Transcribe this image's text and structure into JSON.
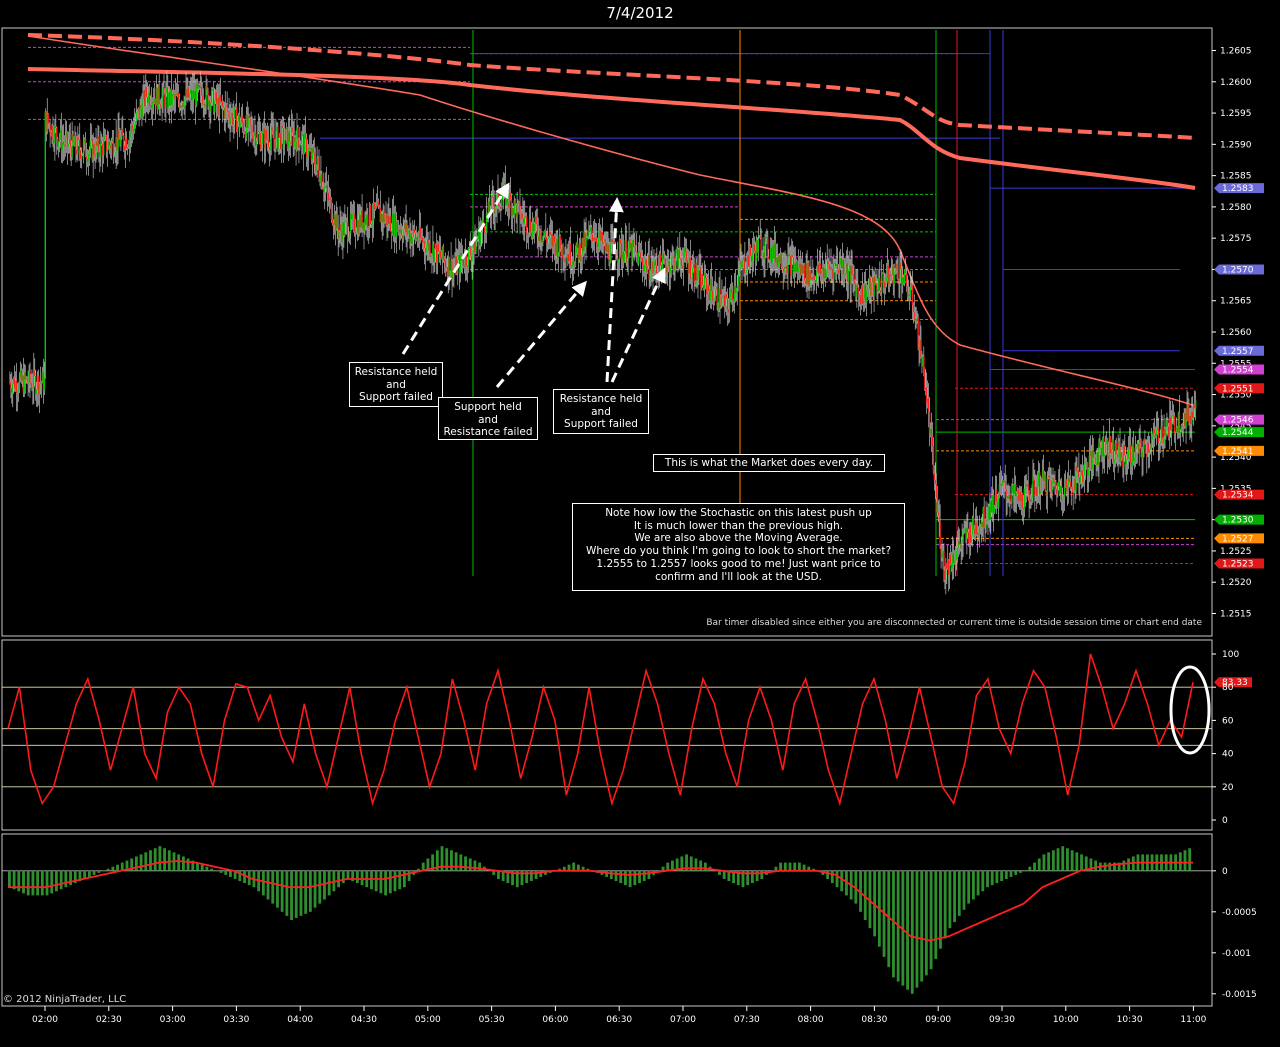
{
  "window": {
    "title": "7/4/2012"
  },
  "status_text": "Bar timer disabled since either you are disconnected or current time is outside session time or chart end date",
  "copyright": "© 2012 NinjaTrader, LLC",
  "annotations": [
    {
      "id": "a1",
      "text": "Resistance held\nand\nSupport failed"
    },
    {
      "id": "a2",
      "text": "Support held\nand\nResistance failed"
    },
    {
      "id": "a3",
      "text": "Resistance held\nand\nSupport failed"
    },
    {
      "id": "a4",
      "text": "This is what the Market does every day."
    },
    {
      "id": "a5",
      "text": "Note how low the Stochastic on this latest push up\nIt is much lower than the previous high.\nWe are also above the Moving Average.\nWhere do you think I'm going to look to short the market?\n1.2555 to 1.2557 looks good to me! Just want price to\nconfirm and I'll look at the USD."
    }
  ],
  "colors": {
    "background": "#000000",
    "up": "#00cc00",
    "down": "#ff2020",
    "ma": "#ff6a5a",
    "stoch": "#ff1a1a",
    "macd_hist": "#2f8f2f",
    "macd_signal": "#ff2020"
  },
  "chart_data": [
    {
      "type": "candlestick",
      "name": "price",
      "x_ticks": [
        "02:00",
        "02:30",
        "03:00",
        "03:30",
        "04:00",
        "04:30",
        "05:00",
        "05:30",
        "06:00",
        "06:30",
        "07:00",
        "07:30",
        "08:00",
        "08:30",
        "09:00",
        "09:30",
        "10:00",
        "10:30",
        "11:00"
      ],
      "ylim": [
        1.2513,
        1.2607
      ],
      "y_ticks": [
        "1.2605",
        "1.2600",
        "1.2595",
        "1.2590",
        "1.2585",
        "1.2580",
        "1.2575",
        "1.2570",
        "1.2565",
        "1.2560",
        "1.2555",
        "1.2550",
        "1.2545",
        "1.2540",
        "1.2535",
        "1.2530",
        "1.2525",
        "1.2520",
        "1.2515"
      ],
      "price_path": [
        [
          0,
          1.2594
        ],
        [
          0.3,
          1.259
        ],
        [
          0.7,
          1.2589
        ],
        [
          1.3,
          1.2591
        ],
        [
          1.6,
          1.2598
        ],
        [
          2,
          1.2597
        ],
        [
          2.5,
          1.2598
        ],
        [
          3,
          1.2594
        ],
        [
          3.4,
          1.2591
        ],
        [
          4,
          1.2591
        ],
        [
          4.3,
          1.2586
        ],
        [
          4.6,
          1.2576
        ],
        [
          5.2,
          1.2579
        ],
        [
          6,
          1.2574
        ],
        [
          6.4,
          1.257
        ],
        [
          6.7,
          1.2573
        ],
        [
          7,
          1.258
        ],
        [
          7.2,
          1.2582
        ],
        [
          7.5,
          1.2578
        ],
        [
          8,
          1.2574
        ],
        [
          8.3,
          1.2572
        ],
        [
          8.6,
          1.2576
        ],
        [
          8.8,
          1.2573
        ],
        [
          9.2,
          1.2573
        ],
        [
          9.5,
          1.257
        ],
        [
          10,
          1.2572
        ],
        [
          10.3,
          1.2568
        ],
        [
          10.7,
          1.2564
        ],
        [
          10.9,
          1.257
        ],
        [
          11.2,
          1.2574
        ],
        [
          11.5,
          1.2572
        ],
        [
          12,
          1.2569
        ],
        [
          12.5,
          1.2571
        ],
        [
          12.8,
          1.2566
        ],
        [
          13.1,
          1.2568
        ],
        [
          13.4,
          1.257
        ],
        [
          13.6,
          1.2565
        ],
        [
          13.8,
          1.2552
        ],
        [
          14,
          1.253
        ],
        [
          14.1,
          1.2522
        ],
        [
          14.4,
          1.2527
        ],
        [
          14.7,
          1.253
        ],
        [
          15,
          1.2535
        ],
        [
          15.3,
          1.2533
        ],
        [
          15.6,
          1.2536
        ],
        [
          16,
          1.2535
        ],
        [
          16.3,
          1.2538
        ],
        [
          16.6,
          1.2542
        ],
        [
          16.9,
          1.254
        ],
        [
          17.2,
          1.2541
        ],
        [
          17.5,
          1.2544
        ],
        [
          17.8,
          1.2546
        ],
        [
          18,
          1.2547
        ],
        [
          18.05,
          1.2552
        ]
      ],
      "y_labels_right": [
        {
          "value": 1.2583,
          "label": "1.2583",
          "bg": "#6a6ad8"
        },
        {
          "value": 1.257,
          "label": "1.2570",
          "bg": "#6a6ad8"
        },
        {
          "value": 1.2557,
          "label": "1.2557",
          "bg": "#6a6ad8"
        },
        {
          "value": 1.2554,
          "label": "1.2554",
          "bg": "#d23fd2"
        },
        {
          "value": 1.2551,
          "label": "1.2551",
          "bg": "#e01818"
        },
        {
          "value": 1.2546,
          "label": "1.2546",
          "bg": "#d23fd2"
        },
        {
          "value": 1.2544,
          "label": "1.2544",
          "bg": "#00b000"
        },
        {
          "value": 1.2541,
          "label": "1.2541",
          "bg": "#ff8c00"
        },
        {
          "value": 1.2534,
          "label": "1.2534",
          "bg": "#e01818"
        },
        {
          "value": 1.253,
          "label": "1.2530",
          "bg": "#00b000"
        },
        {
          "value": 1.2527,
          "label": "1.2527",
          "bg": "#ff8c00"
        },
        {
          "value": 1.2523,
          "label": "1.2523",
          "bg": "#e01818"
        }
      ]
    },
    {
      "type": "line",
      "name": "stochastic",
      "ylim": [
        0,
        100
      ],
      "y_ticks": [
        "100",
        "80",
        "60",
        "40",
        "20",
        "0"
      ],
      "levels": [
        80,
        55,
        45,
        20
      ],
      "last_label": "83.33",
      "values": [
        55,
        80,
        30,
        10,
        20,
        45,
        70,
        85,
        60,
        30,
        55,
        80,
        40,
        25,
        65,
        80,
        70,
        40,
        20,
        60,
        82,
        80,
        60,
        75,
        50,
        35,
        70,
        40,
        20,
        50,
        80,
        40,
        10,
        30,
        60,
        80,
        50,
        20,
        40,
        85,
        60,
        30,
        70,
        90,
        60,
        25,
        50,
        80,
        60,
        15,
        40,
        80,
        40,
        10,
        30,
        60,
        90,
        70,
        40,
        15,
        55,
        85,
        70,
        40,
        20,
        60,
        80,
        60,
        30,
        70,
        85,
        60,
        30,
        10,
        40,
        70,
        85,
        60,
        25,
        50,
        80,
        50,
        20,
        10,
        35,
        75,
        85,
        55,
        40,
        70,
        90,
        80,
        50,
        15,
        45,
        100,
        80,
        55,
        70,
        90,
        70,
        45,
        60,
        50,
        83
      ]
    },
    {
      "type": "bar",
      "name": "macd",
      "ylim": [
        -0.0016,
        0.0004
      ],
      "y_ticks": [
        "0",
        "-0.0005",
        "-0.001",
        "-0.0015"
      ],
      "hist": [
        -0.0002,
        -0.0003,
        -0.0003,
        -0.0002,
        -0.0001,
        0,
        0.0001,
        0.0002,
        0.0003,
        0.0002,
        0.0001,
        0,
        -0.0001,
        -0.0002,
        -0.0004,
        -0.0006,
        -0.0005,
        -0.0003,
        -0.0001,
        -0.0002,
        -0.0003,
        -0.0002,
        0.0001,
        0.0003,
        0.0002,
        0.0001,
        -0.0001,
        -0.0002,
        -0.0001,
        0,
        0.0001,
        0,
        -0.0001,
        -0.0002,
        -0.0001,
        0.0001,
        0.0002,
        0.0001,
        -0.0001,
        -0.0002,
        -0.0001,
        0.0001,
        0.0001,
        0,
        -0.0002,
        -0.0004,
        -0.0008,
        -0.0013,
        -0.0015,
        -0.0012,
        -0.0007,
        -0.0004,
        -0.0002,
        -0.0001,
        0,
        0.0002,
        0.0003,
        0.0002,
        0.0001,
        0.0001,
        0.0002,
        0.0002,
        0.0002,
        0.0003
      ],
      "signal": [
        -0.0002,
        -0.0002,
        -0.0002,
        -0.00015,
        -0.0001,
        -5e-05,
        0,
        5e-05,
        0.0001,
        0.00012,
        0.0001,
        5e-05,
        0,
        -0.0001,
        -0.00015,
        -0.0002,
        -0.0002,
        -0.00015,
        -0.0001,
        -0.0001,
        -0.0001,
        -5e-05,
        0,
        5e-05,
        5e-05,
        3e-05,
        0,
        -3e-05,
        -3e-05,
        0,
        0,
        0,
        -3e-05,
        -5e-05,
        -3e-05,
        0,
        3e-05,
        3e-05,
        0,
        -3e-05,
        -3e-05,
        0,
        0,
        0,
        -5e-05,
        -0.0002,
        -0.0004,
        -0.0006,
        -0.0008,
        -0.00085,
        -0.0008,
        -0.0007,
        -0.0006,
        -0.0005,
        -0.0004,
        -0.0002,
        -0.0001,
        0,
        5e-05,
        8e-05,
        0.0001,
        0.0001,
        0.0001,
        0.0001
      ]
    }
  ]
}
